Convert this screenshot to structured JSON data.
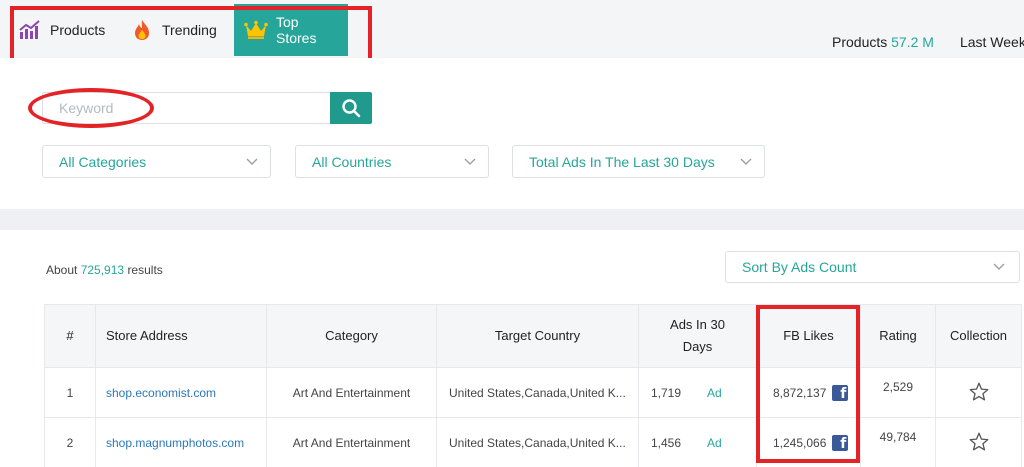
{
  "tabs": [
    {
      "label": "Products",
      "icon": "bar-chart-icon"
    },
    {
      "label": "Trending",
      "icon": "flame-icon"
    },
    {
      "label": "Top Stores",
      "icon": "crown-icon"
    }
  ],
  "stats": {
    "products_label": "Products",
    "products_value": "57.2 M",
    "last_label": "Last Week"
  },
  "search": {
    "placeholder": "Keyword",
    "value": ""
  },
  "filters": {
    "category": "All Categories",
    "country": "All Countries",
    "ads_range": "Total Ads In The Last 30 Days"
  },
  "results": {
    "prefix": "About",
    "count": "725,913",
    "suffix": "results"
  },
  "sort": {
    "label": "Sort By Ads Count"
  },
  "table": {
    "headers": {
      "num": "#",
      "store": "Store Address",
      "category": "Category",
      "country": "Target Country",
      "ads": "Ads In 30 Days",
      "fb": "FB Likes",
      "rating": "Rating",
      "collection": "Collection"
    },
    "rows": [
      {
        "num": "1",
        "store": "shop.economist.com",
        "category": "Art And Entertainment",
        "country": "United States,Canada,United K...",
        "ads": "1,719",
        "ad_link": "Ad",
        "fb": "8,872,137",
        "rating": "2,529"
      },
      {
        "num": "2",
        "store": "shop.magnumphotos.com",
        "category": "Art And Entertainment",
        "country": "United States,Canada,United K...",
        "ads": "1,456",
        "ad_link": "Ad",
        "fb": "1,245,066",
        "rating": "49,784"
      }
    ]
  },
  "colors": {
    "accent": "#26a69a",
    "highlight": "#e42326",
    "link": "#2b77b9",
    "facebook": "#3b5998"
  }
}
